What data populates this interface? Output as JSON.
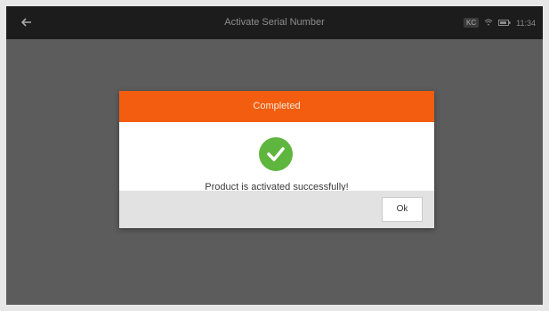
{
  "header": {
    "title": "Activate Serial Number",
    "status": {
      "badge": "KC",
      "battery": "11:34"
    }
  },
  "dialog": {
    "title": "Completed",
    "message": "Product is activated successfully!",
    "ok_label": "Ok"
  },
  "colors": {
    "accent": "#f25d0f",
    "success": "#5fb63e",
    "topbar": "#1c1c1c",
    "backdrop": "#5c5c5c"
  },
  "icons": {
    "back": "back-arrow-icon",
    "success": "check-circle-icon",
    "wifi": "wifi-icon",
    "battery": "battery-icon"
  }
}
